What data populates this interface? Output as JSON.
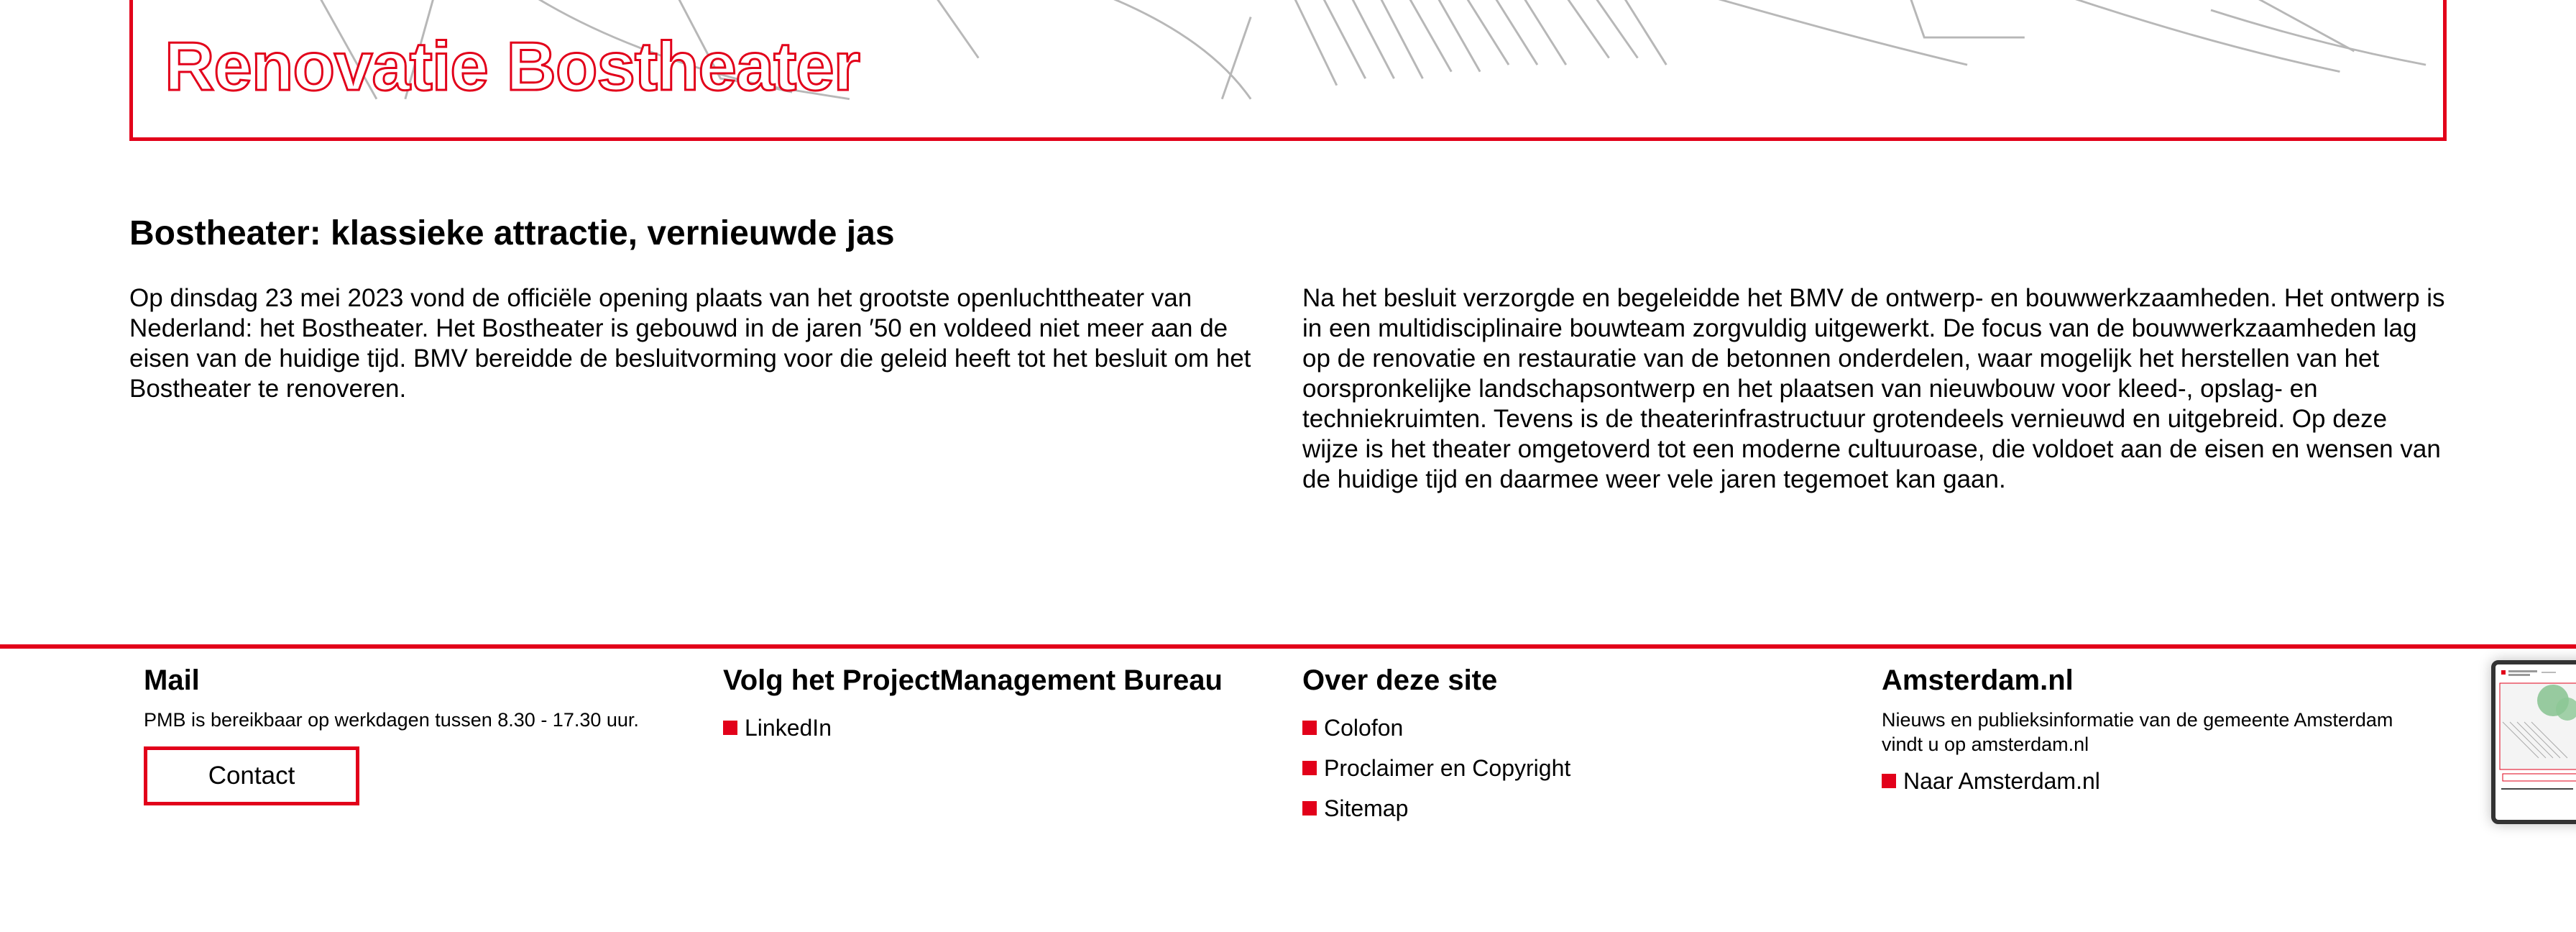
{
  "hero": {
    "title": "Renovatie Bostheater"
  },
  "article": {
    "heading": "Bostheater: klassieke attractie, vernieuwde jas",
    "left_paragraph": "Op dinsdag 23 mei 2023 vond de officiële opening plaats van het grootste openluchttheater van Nederland: het Bostheater. Het Bostheater is gebouwd in de jaren ′50 en voldeed niet meer aan de eisen van de huidige tijd. BMV bereidde de besluitvorming voor die geleid heeft tot het besluit om het Bostheater te renoveren.",
    "right_paragraph": "Na het besluit verzorgde en begeleidde het BMV de ontwerp- en bouwwerkzaamheden. Het ontwerp is in een multidisciplinaire bouwteam zorgvuldig uitgewerkt. De focus van de bouwwerkzaamheden lag op de renovatie en restauratie van de betonnen onderdelen, waar mogelijk het herstellen van het oorspronkelijke landschapsontwerp en het plaatsen van nieuwbouw voor kleed-, opslag- en techniekruimten. Tevens is de theaterinfrastructuur grotendeels vernieuwd en uitgebreid. Op deze wijze is het theater omgetoverd tot een moderne cultuuroase, die voldoet aan de eisen en wensen van de huidige tijd en daarmee weer vele jaren tegemoet kan gaan."
  },
  "footer": {
    "mail": {
      "heading": "Mail",
      "text": "PMB is bereikbaar op werkdagen tussen 8.30 - 17.30 uur.",
      "contact_label": "Contact"
    },
    "follow": {
      "heading": "Volg het ProjectManagement Bureau",
      "links": [
        "LinkedIn"
      ]
    },
    "about": {
      "heading": "Over deze site",
      "links": [
        "Colofon",
        "Proclaimer en Copyright",
        "Sitemap"
      ]
    },
    "amsterdam": {
      "heading": "Amsterdam.nl",
      "text": "Nieuws en publieksinformatie van de gemeente Amsterdam vindt u op amsterdam.nl",
      "link": "Naar Amsterdam.nl"
    }
  },
  "colors": {
    "accent": "#e2001a",
    "text": "#000000",
    "background": "#ffffff"
  }
}
